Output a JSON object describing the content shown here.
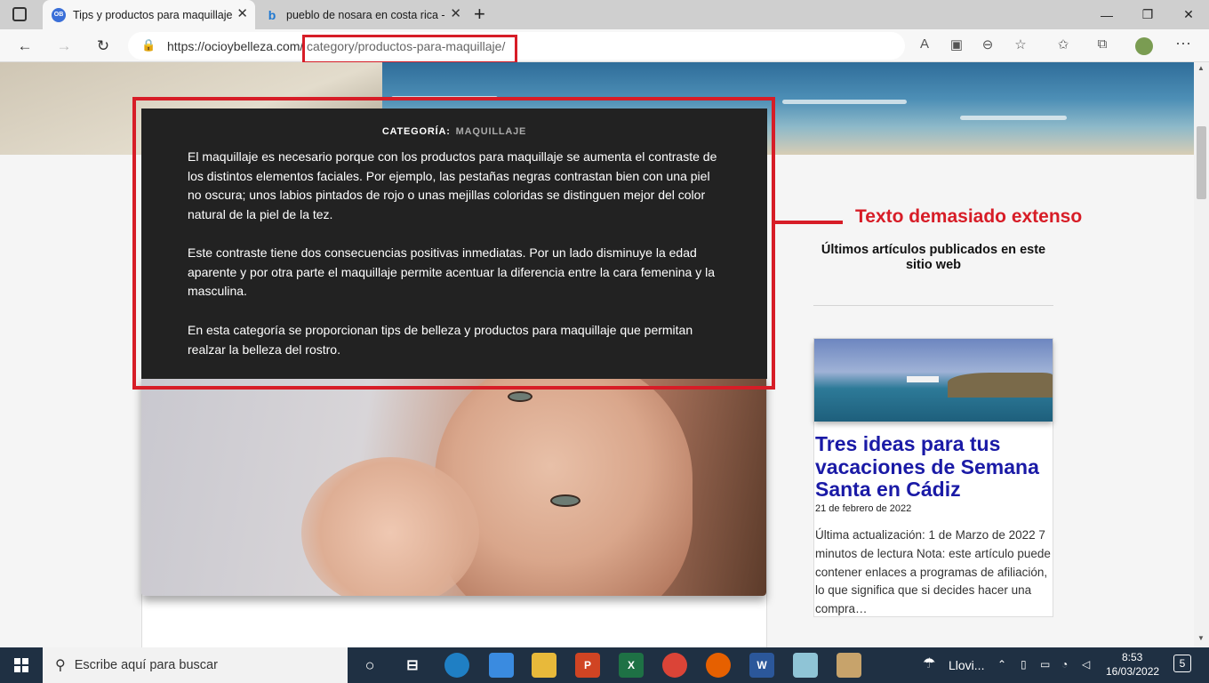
{
  "tabs": [
    {
      "title": "Tips y productos para maquillaje",
      "favicon_text": "OB"
    },
    {
      "title": "pueblo de nosara en costa rica -",
      "favicon_text": "b"
    }
  ],
  "address": {
    "host": "https://ocioybelleza.com/",
    "path": "category/productos-para-maquillaje/"
  },
  "category": {
    "label": "CATEGORÍA:",
    "value": "MAQUILLAJE",
    "paragraphs": [
      "El maquillaje es necesario porque con los productos para maquillaje se aumenta el contraste de los distintos elementos faciales. Por ejemplo, las pestañas negras contrastan bien con una piel no oscura; unos labios pintados de rojo o unas mejillas coloridas se distinguen mejor del color natural de la piel de la tez.",
      "Este contraste tiene dos consecuencias positivas inmediatas. Por un lado disminuye la edad aparente y por otra parte el maquillaje permite acentuar la diferencia entre la cara femenina y la masculina.",
      "En esta categoría se proporcionan tips de belleza y productos para maquillaje que permitan realzar la belleza del rostro."
    ]
  },
  "annotation": {
    "text": "Texto demasiado extenso",
    "color": "#d71d27"
  },
  "sidebar": {
    "title": "Últimos artículos publicados en este sitio web",
    "post": {
      "title": "Tres ideas para tus vacaciones de Semana Santa en Cádiz",
      "date": "21 de febrero de 2022",
      "excerpt": "Última actualización: 1 de Marzo de 2022 7 minutos de lectura Nota: este artículo puede contener enlaces a programas de afiliación, lo que significa que si decides hacer una compra…"
    }
  },
  "taskbar": {
    "search_placeholder": "Escribe aquí para buscar",
    "weather": "Llovi...",
    "time": "8:53",
    "date": "16/03/2022",
    "notifications": "5"
  }
}
